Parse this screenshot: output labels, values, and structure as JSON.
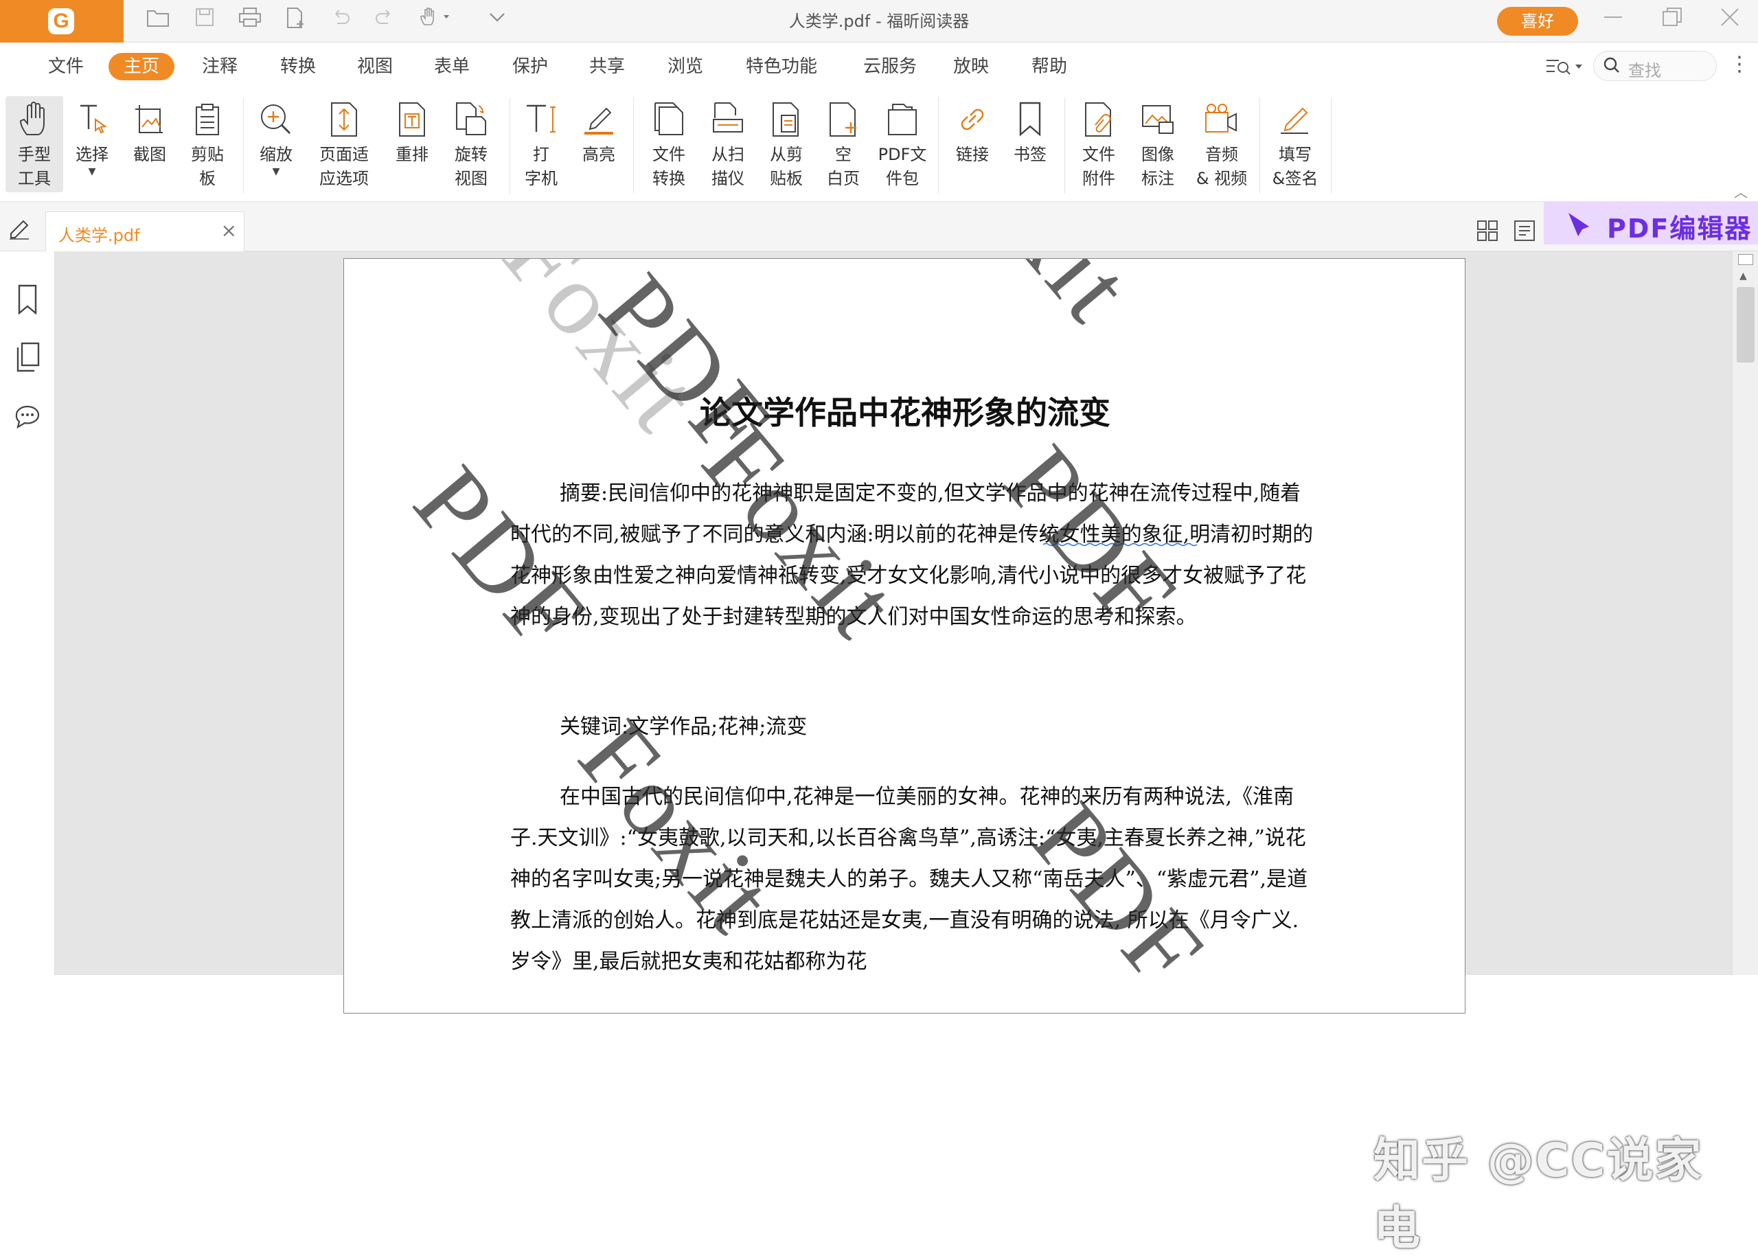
{
  "window": {
    "title": "人类学.pdf - 福昕阅读器",
    "like_button": "喜好"
  },
  "menu": {
    "items": [
      {
        "label": "文件",
        "active": false
      },
      {
        "label": "主页",
        "active": true
      },
      {
        "label": "注释",
        "active": false
      },
      {
        "label": "转换",
        "active": false
      },
      {
        "label": "视图",
        "active": false
      },
      {
        "label": "表单",
        "active": false
      },
      {
        "label": "保护",
        "active": false
      },
      {
        "label": "共享",
        "active": false
      },
      {
        "label": "浏览",
        "active": false
      },
      {
        "label": "特色功能",
        "active": false
      },
      {
        "label": "云服务",
        "active": false
      },
      {
        "label": "放映",
        "active": false
      },
      {
        "label": "帮助",
        "active": false
      }
    ],
    "search_placeholder": "查找"
  },
  "ribbon": {
    "tools": [
      {
        "label": "手型\n工具",
        "icon": "hand-icon"
      },
      {
        "label": "选择",
        "icon": "select-text-icon"
      },
      {
        "label": "截图",
        "icon": "snapshot-icon"
      },
      {
        "label": "剪贴\n板",
        "icon": "clipboard-icon"
      },
      {
        "label": "缩放",
        "icon": "zoom-icon"
      },
      {
        "label": "页面适\n应选项",
        "icon": "fit-page-icon"
      },
      {
        "label": "重排",
        "icon": "reflow-icon"
      },
      {
        "label": "旋转\n视图",
        "icon": "rotate-view-icon"
      },
      {
        "label": "打\n字机",
        "icon": "typewriter-icon"
      },
      {
        "label": "高亮",
        "icon": "highlight-icon"
      },
      {
        "label": "文件\n转换",
        "icon": "file-convert-icon"
      },
      {
        "label": "从扫\n描仪",
        "icon": "scanner-icon"
      },
      {
        "label": "从剪\n贴板",
        "icon": "from-clipboard-icon"
      },
      {
        "label": "空\n白页",
        "icon": "blank-page-icon"
      },
      {
        "label": "PDF文\n件包",
        "icon": "pdf-package-icon"
      },
      {
        "label": "链接",
        "icon": "link-icon"
      },
      {
        "label": "书签",
        "icon": "bookmark-icon"
      },
      {
        "label": "文件\n附件",
        "icon": "attachment-icon"
      },
      {
        "label": "图像\n标注",
        "icon": "image-annotation-icon"
      },
      {
        "label": "音频\n& 视频",
        "icon": "audio-video-icon"
      },
      {
        "label": "填写\n&签名",
        "icon": "fill-sign-icon"
      }
    ]
  },
  "tabs": {
    "doc_tab": "人类学.pdf",
    "editor_badge": "PDF编辑器"
  },
  "document": {
    "title": "论文学作品中花神形象的流变",
    "abstract": "摘要:民间信仰中的花神神职是固定不变的,但文学作品中的花神在流传过程中,随着时代的不同,被赋予了不同的意义和内涵:明以前的花神是传统女性美的象征,明清初时期的花神形象由性爱之神向爱情神祗转变,受才女文化影响,清代小说中的很多才女被赋予了花神的身份,变现出了处于封建转型期的文人们对中国女性命运的思考和探索。",
    "keywords": "关键词:文学作品;花神;流变",
    "body": "在中国古代的民间信仰中,花神是一位美丽的女神。花神的来历有两种说法,《淮南子.天文训》:“女夷鼓歌,以司天和,以长百谷禽鸟草”,高诱注:“女夷,主春夏长养之神,”说花神的名字叫女夷;另一说花神是魏夫人的弟子。魏夫人又称“南岳夫人”、“紫虚元君”,是道教上清派的创始人。花神到底是花姑还是女夷,一直没有明确的说法, 所以在《月令广义.岁令》里,最后就把女夷和花姑都称为花",
    "watermarks": [
      "PDF",
      "Foxit",
      "PDF",
      "Foxit",
      "Foxit",
      "PDF",
      "Foxit",
      "PDF"
    ]
  },
  "overlay_text": "知乎 @CC说家电"
}
